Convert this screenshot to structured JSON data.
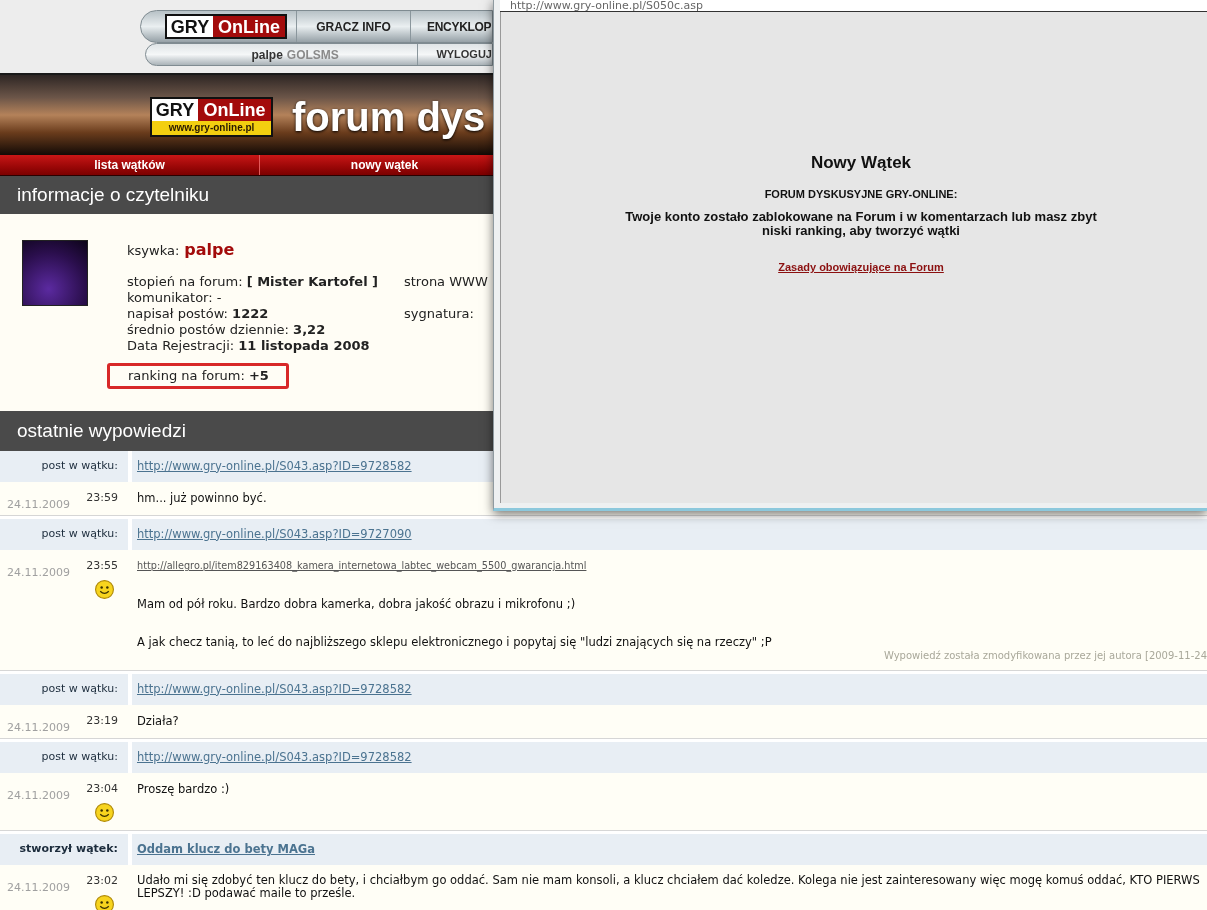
{
  "top_nav": {
    "logo": [
      "GRY",
      "OnLine"
    ],
    "links": [
      "GRACZ INFO",
      "ENCYKLOP"
    ],
    "user": {
      "name": "palpe",
      "service": "GOLSMS"
    },
    "logout": "WYLOGUJ"
  },
  "banner": {
    "logo": {
      "words": [
        "GRY",
        "OnLine"
      ],
      "url": "www.gry-online.pl"
    },
    "title": "forum dys"
  },
  "forum_nav": [
    "lista wątków",
    "nowy wątek"
  ],
  "profile": {
    "heading": "informacje o czytelniku",
    "nickname": {
      "label": "ksywka:",
      "value": "palpe"
    },
    "fields": [
      "stopień na forum: **[ Mister Kartofel ]**",
      "komunikator: -",
      "napisał postów: **1222**",
      "średnio postów dziennie: **3,22**",
      "Data Rejestracji: **11 listopada 2008**"
    ],
    "side_fields": [
      "strona WWW",
      "sygnatura:"
    ],
    "ranking": {
      "text": "ranking na forum: **+5**",
      "highlighted": true
    }
  },
  "posts": {
    "heading": "ostatnie wypowiedzi",
    "items": [
      {
        "kind": "reply",
        "label": "post w wątku:",
        "thread": "http://www.gry-online.pl/S043.asp?ID=9728582",
        "date": "24.11.2009",
        "time": "23:59",
        "smiley": false,
        "body": [
          {
            "kind": "text",
            "lines": [
              "hm... już powinno być."
            ]
          }
        ]
      },
      {
        "kind": "reply",
        "label": "post w wątku:",
        "thread": "http://www.gry-online.pl/S043.asp?ID=9727090",
        "date": "24.11.2009",
        "time": "23:55",
        "smiley": true,
        "body": [
          {
            "kind": "link",
            "text": "http://allegro.pl/item829163408_kamera_internetowa_labtec_webcam_5500_gwarancja.html"
          },
          {
            "kind": "text",
            "lines": [
              "Mam od pół roku. Bardzo dobra kamerka, dobra jakość obrazu i mikrofonu ;)"
            ]
          },
          {
            "kind": "text",
            "lines": [
              "A jak checz tanią, to leć do najbliższego sklepu elektronicznego i popytaj się \"ludzi znających się na rzeczy\" ;P"
            ]
          }
        ],
        "edit_note": "Wypowiedź została zmodyfikowana przez jej autora [2009-11-24"
      },
      {
        "kind": "reply",
        "label": "post w wątku:",
        "thread": "http://www.gry-online.pl/S043.asp?ID=9728582",
        "date": "24.11.2009",
        "time": "23:19",
        "smiley": false,
        "body": [
          {
            "kind": "text",
            "lines": [
              "Działa?"
            ]
          }
        ]
      },
      {
        "kind": "reply",
        "label": "post w wątku:",
        "thread": "http://www.gry-online.pl/S043.asp?ID=9728582",
        "date": "24.11.2009",
        "time": "23:04",
        "smiley": true,
        "body": [
          {
            "kind": "text",
            "lines": [
              "Proszę bardzo :)"
            ]
          }
        ]
      },
      {
        "kind": "thread",
        "label": "stworzył wątek:",
        "thread": "Oddam klucz do bety MAGa",
        "date": "24.11.2009",
        "time": "23:02",
        "smiley": true,
        "body": [
          {
            "kind": "text",
            "lines": [
              "Udało mi się zdobyć ten klucz do bety, i chciałbym go oddać. Sam nie mam konsoli, a klucz chciałem dać koledze. Kolega nie jest zainteresowany więc mogę komuś oddać, KTO PIERWS",
              "LEPSZY! :D podawać maile to prześle."
            ]
          }
        ]
      }
    ]
  },
  "popup": {
    "address": "http://www.gry-online.pl/S050c.asp",
    "title": "Nowy Wątek",
    "subtitle": "FORUM DYSKUSYJNE GRY-ONLINE:",
    "message": "Twoje konto zostało zablokowane na Forum i w komentarzach lub masz zbyt niski ranking, aby tworzyć wątki",
    "link": "Zasady obowiązujące na Forum"
  }
}
